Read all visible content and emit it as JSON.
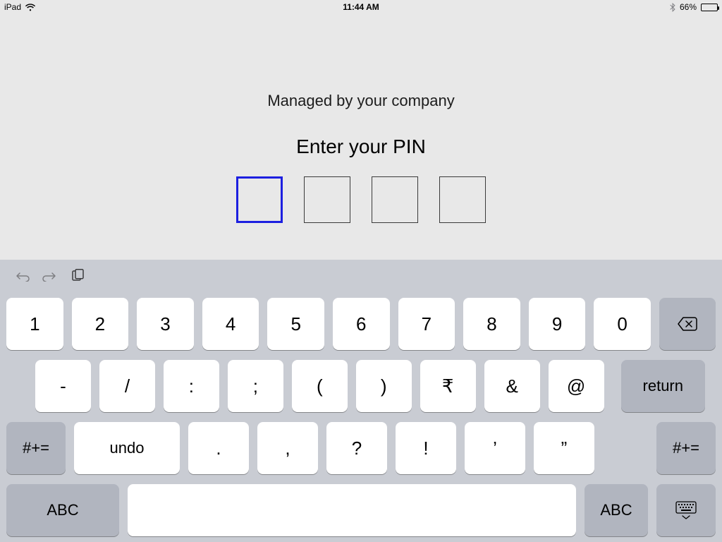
{
  "status": {
    "device": "iPad",
    "time": "11:44 AM",
    "battery_pct": "66%",
    "battery_fill_pct": 66
  },
  "pin": {
    "managed": "Managed by your company",
    "prompt": "Enter your PIN",
    "digits": 4,
    "active_index": 0
  },
  "keyboard": {
    "row1": [
      "1",
      "2",
      "3",
      "4",
      "5",
      "6",
      "7",
      "8",
      "9",
      "0"
    ],
    "row2": [
      "-",
      "/",
      ":",
      ";",
      "(",
      ")",
      "₹",
      "&",
      "@"
    ],
    "row2_return": "return",
    "row3_mode_left": "#+=",
    "row3_undo": "undo",
    "row3": [
      ".",
      ",",
      "?",
      "!",
      "’",
      "”"
    ],
    "row3_mode_right": "#+=",
    "row4_abc": "ABC"
  }
}
